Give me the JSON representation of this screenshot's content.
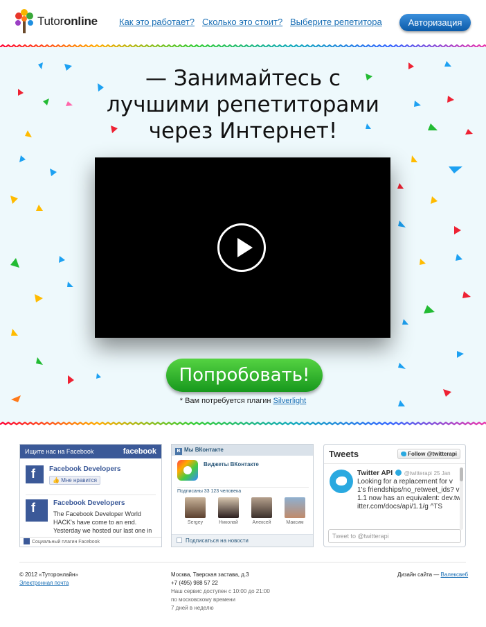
{
  "header": {
    "logo_text_regular": "Tutor",
    "logo_text_bold": "online",
    "nav": [
      {
        "label": "Как это работает?"
      },
      {
        "label": "Сколько это стоит?"
      },
      {
        "label": "Выберите репетитора"
      }
    ],
    "auth_button": "Авторизация"
  },
  "hero": {
    "title": "— Занимайтесь с лучшими репетиторами через Интернет!",
    "cta_button": "Попробовать!",
    "plugin_note": "* Вам потребуется плагин",
    "plugin_link": "Silverlight"
  },
  "facebook": {
    "header": "Ищите нас на Facebook",
    "brand": "facebook",
    "page_name": "Facebook Developers",
    "like_label": "Мне нравится",
    "post_author": "Facebook Developers",
    "post_text": "The Facebook Developer World HACK's have come to an end. Yesterday we hosted our last one in",
    "footer": "Социальный плагин Facebook"
  },
  "vk": {
    "header": "Мы ВКонтакте",
    "group_name": "Виджеты ВКонтакте",
    "subscribers": "Подписаны 33 123 человека",
    "people": [
      {
        "name": "Sergey",
        "color": "#8a6a55"
      },
      {
        "name": "Николай",
        "color": "#5a4a48"
      },
      {
        "name": "Алексей",
        "color": "#6b5a50"
      },
      {
        "name": "Максим",
        "color": "#9c7b66"
      }
    ],
    "subscribe_label": "Подписаться на новости"
  },
  "twitter": {
    "title": "Tweets",
    "follow_label": "Follow @twitterapi",
    "tweet": {
      "author": "Twitter API",
      "handle": "@twitterapi",
      "date": "25 Jan",
      "text": "Looking for a replacement for v1's friendships/no_retweet_ids? v1.1 now has an equivalent: dev.twitter.com/docs/api/1.1/g ^TS"
    },
    "input_placeholder": "Tweet to @twitterapi"
  },
  "footer": {
    "copyright": "© 2012 «Туторонлайн»",
    "email_link": "Электронная почта",
    "address": "Москва, Тверская застава, д.3",
    "phone": "+7 (495) 988 57 22",
    "hours_1": "Наш сервис доступен с 10:00 до 21:00",
    "hours_2": "по московскому времени",
    "hours_3": "7 дней в неделю",
    "design_label": "Дизайн сайта —",
    "design_link": "Валексвеб"
  },
  "colors": {
    "link": "#1a6fb5",
    "auth_button": "#0b5aa8",
    "cta_button": "#17981d",
    "hero_background": "#eef9fc",
    "facebook": "#3b5998",
    "twitter": "#2aa9e0"
  },
  "icons": [
    "tree-logo-icon",
    "play-icon",
    "facebook-icon",
    "vk-icon",
    "twitter-bird-icon",
    "verified-icon",
    "like-icon"
  ]
}
